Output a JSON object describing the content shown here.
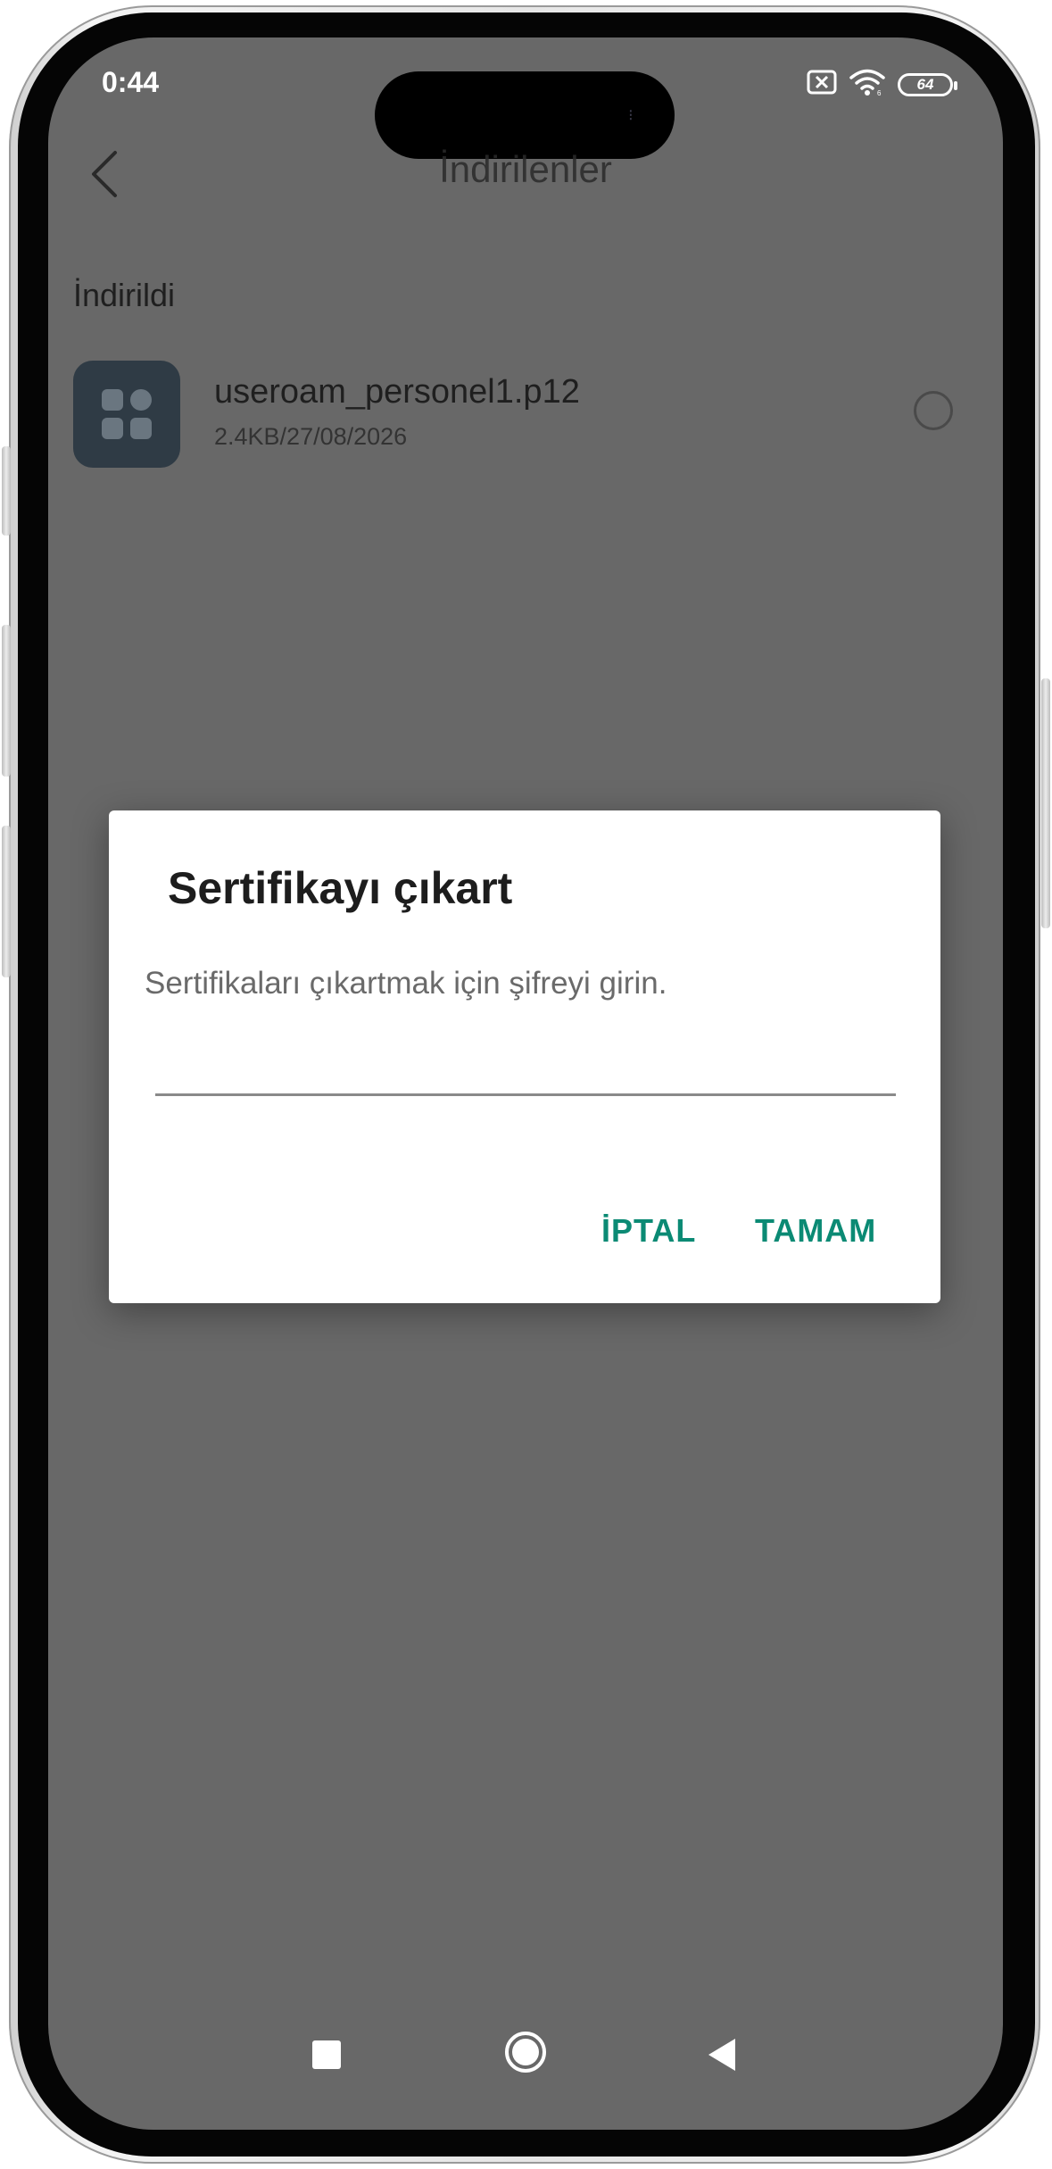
{
  "status_bar": {
    "time": "0:44",
    "battery_level": "64",
    "icons": [
      "sim-off-icon",
      "wifi-icon",
      "battery-icon"
    ]
  },
  "header": {
    "title": "İndirilenler",
    "back_icon": "chevron-left-icon"
  },
  "section": {
    "label": "İndirildi"
  },
  "file": {
    "name": "useroam_personel1.p12",
    "meta": "2.4KB/27/08/2026",
    "icon": "app-grid-icon",
    "selected": false
  },
  "dialog": {
    "title": "Sertifikayı çıkart",
    "message": "Sertifikaları çıkartmak için şifreyi girin.",
    "input_value": "",
    "cancel_label": "İPTAL",
    "ok_label": "TAMAM",
    "accent_color": "#0b8a74"
  },
  "nav_bar": {
    "icons": [
      "recents-square-icon",
      "home-circle-icon",
      "back-triangle-icon"
    ]
  },
  "colors": {
    "scrim": "#686868",
    "dialog_bg": "#ffffff",
    "file_icon_bg": "#2f3b45"
  }
}
